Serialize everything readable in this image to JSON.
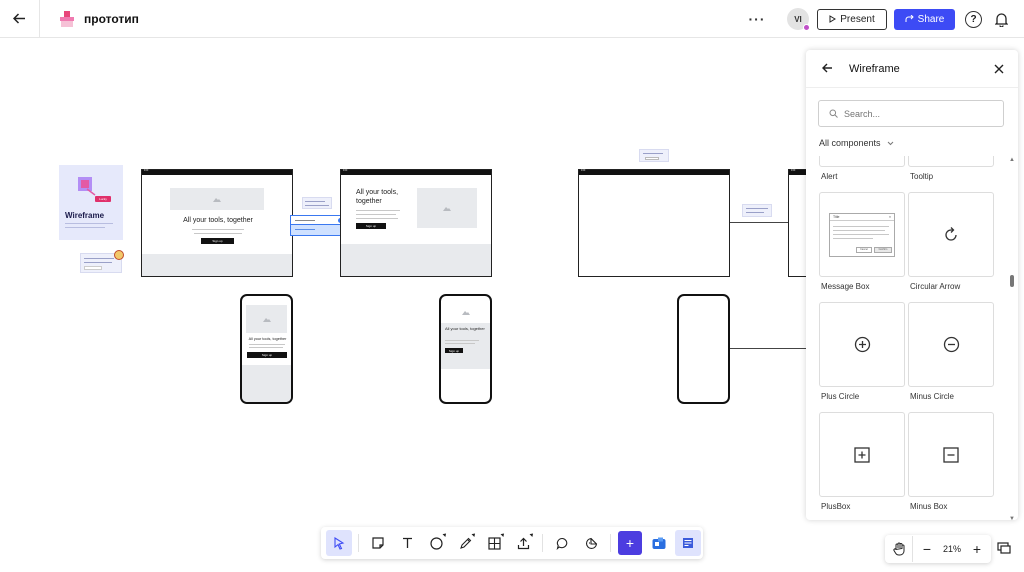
{
  "topbar": {
    "back_icon": "arrow-left-icon",
    "board_title": "прототип",
    "more_label": "···",
    "avatar_initials": "VI",
    "present_label": "Present",
    "share_label": "Share",
    "help_label": "?",
    "accent_color": "#3d4bf5"
  },
  "canvas": {
    "cover_title": "Wireframe",
    "cover_badge": "Lucky",
    "desktop_heading_1": "All your tools, together",
    "desktop_heading_2": "All your tools, together",
    "mobile_heading_1": "All your tools, together",
    "mobile_heading_2": "All your tools, together",
    "cta_label": "Sign up"
  },
  "panel": {
    "title": "Wireframe",
    "search_placeholder": "Search...",
    "filter_label": "All components",
    "items": [
      {
        "label": "Alert",
        "icon": "alert-component"
      },
      {
        "label": "Tooltip",
        "icon": "tooltip-component"
      },
      {
        "label": "Message Box",
        "icon": "message-box-component"
      },
      {
        "label": "Circular Arrow",
        "icon": "circular-arrow-icon"
      },
      {
        "label": "Plus Circle",
        "icon": "plus-circle-icon"
      },
      {
        "label": "Minus Circle",
        "icon": "minus-circle-icon"
      },
      {
        "label": "PlusBox",
        "icon": "plus-box-icon"
      },
      {
        "label": "Minus Box",
        "icon": "minus-box-icon"
      }
    ],
    "message_box": {
      "title": "Title",
      "ok_label": "Confirm",
      "cancel_label": "Cancel"
    }
  },
  "toolbar": {
    "tools": [
      "select",
      "sticky-note",
      "text",
      "shapes",
      "pen",
      "table",
      "upload",
      "comment",
      "sticker",
      "more-apps",
      "app-one",
      "templates"
    ]
  },
  "zoom": {
    "value": "21%",
    "minus": "−",
    "plus": "+"
  }
}
